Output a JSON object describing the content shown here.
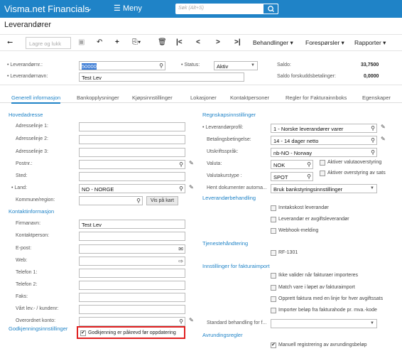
{
  "topbar": {
    "brand": "Visma.net Financials",
    "menu_label": "Meny",
    "search_placeholder": "Søk (Alt+S)"
  },
  "page": {
    "title": "Leverandører"
  },
  "toolbar": {
    "save_close": "Lagre og lukk",
    "actions": "Behandlinger",
    "inquiries": "Forespørsler",
    "reports": "Rapporter"
  },
  "header": {
    "vendor_no_label": "Leverandørnr.:",
    "vendor_no_value": "50000",
    "vendor_name_label": "Leverandørnavn:",
    "vendor_name_value": "Test Lev",
    "status_label": "Status:",
    "status_value": "Aktiv",
    "balance_label": "Saldo:",
    "balance_value": "33,7500",
    "prepay_label": "Saldo forskuddsbetalinger:",
    "prepay_value": "0,0000"
  },
  "tabs": [
    "Generell informasjon",
    "Bankopplysninger",
    "Kjøpsinnstillinger",
    "Lokasjoner",
    "Kontaktpersoner",
    "Regler for Fakturainnboks",
    "Egenskaper"
  ],
  "left": {
    "address_section": "Hovedadresse",
    "addr1": "Adresselinje 1:",
    "addr2": "Adresselinje 2:",
    "addr3": "Adresselinje 3:",
    "postal": "Postnr.:",
    "city": "Sted:",
    "country_label": "Land:",
    "country_value": "NO - NORGE",
    "county": "Kommune/region:",
    "map_button": "Vis på kart",
    "contact_section": "Kontaktinformasjon",
    "company_label": "Firmanavn:",
    "company_value": "Test Lev",
    "contact_person": "Kontaktperson:",
    "email": "E-post:",
    "web": "Web:",
    "phone1": "Telefon 1:",
    "phone2": "Telefon 2:",
    "fax": "Faks:",
    "our_account": "Vårt lev.- / kundenr:",
    "parent_account": "Overordnet konto:",
    "approval_section": "Godkjenningsinnstillinger",
    "approval_checkbox": "Godkjenning er påkrevd før oppdatering"
  },
  "right": {
    "accounting_section": "Regnskapsinnstillinger",
    "vendor_profile_label": "Leverandørprofil:",
    "vendor_profile_value": "1 - Norske leverandører varer",
    "terms_label": "Betalingsbetingelse:",
    "terms_value": "14 - 14 dager netto",
    "print_lang_label": "Utskriftsspråk:",
    "print_lang_value": "nb-NO - Norway",
    "currency_label": "Valuta:",
    "currency_value": "NOK",
    "rate_type_label": "Valutakurstype :",
    "rate_type_value": "SPOT",
    "enable_currency_override": "Aktiver valutaoverstyring",
    "enable_rate_override": "Aktiver overstyring av sats",
    "fetch_docs_label": "Hent dokumenter automa...",
    "fetch_docs_value": "Bruk bankstyringsinnstillinger",
    "vendor_handling_section": "Leverandørbehandling",
    "landed_cost": "Inntakskost leverandør",
    "tax_agency": "Leverandør er avgiftsleverandør",
    "webhook": "Webhook-melding",
    "service_section": "Tjenestehåndtering",
    "rf1301": "RF-1301",
    "invoice_import_section": "Innstillinger for fakturaimport",
    "no_validate": "Ikke valider når fakturaer importeres",
    "match_item": "Match vare i løpet av fakturaimport",
    "create_line": "Opprett faktura med en linje for hver avgiftssats",
    "import_amounts": "Importer beløp fra fakturahode pr. mva.-kode",
    "standard_handling_label": "Standard behandling for f...",
    "rounding_section": "Avrundingsregler",
    "manual_rounding": "Manuell registrering av avrundingsbeløp"
  }
}
